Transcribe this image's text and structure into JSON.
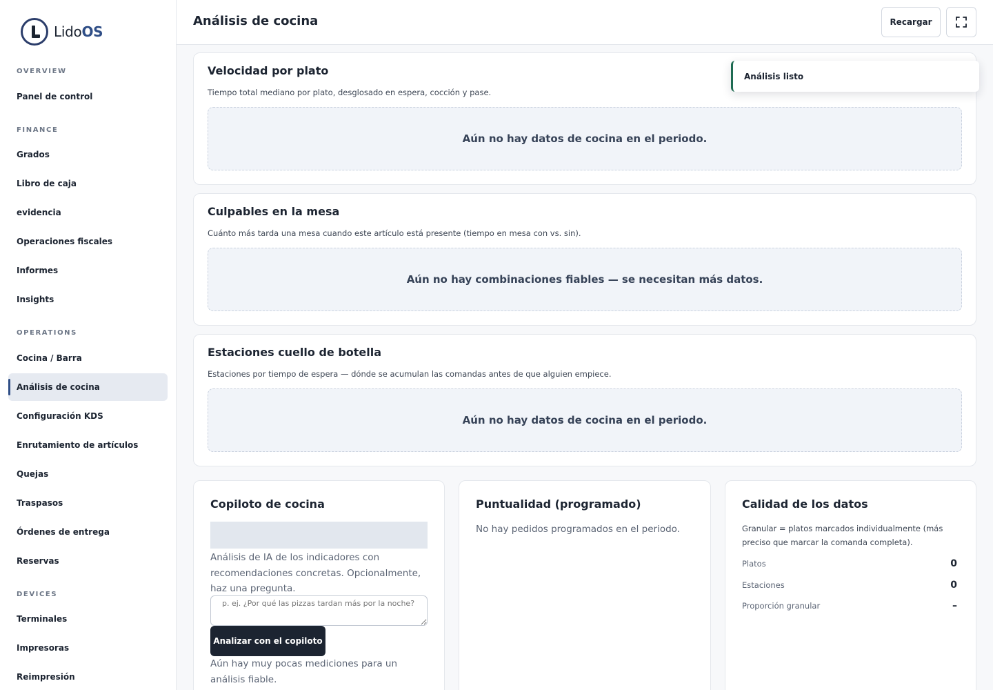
{
  "app": {
    "logo_main": "Lido",
    "logo_accent": "OS"
  },
  "sidebar": {
    "sections": [
      {
        "label": "OVERVIEW"
      },
      {
        "label": "FINANCE"
      },
      {
        "label": "OPERATIONS"
      },
      {
        "label": "DEVICES"
      }
    ],
    "items": [
      {
        "label": "Panel de control"
      },
      {
        "label": "Grados"
      },
      {
        "label": "Libro de caja"
      },
      {
        "label": "evidencia"
      },
      {
        "label": "Operaciones fiscales"
      },
      {
        "label": "Informes"
      },
      {
        "label": "Insights"
      },
      {
        "label": "Cocina / Barra"
      },
      {
        "label": "Análisis de cocina"
      },
      {
        "label": "Configuración KDS"
      },
      {
        "label": "Enrutamiento de artículos"
      },
      {
        "label": "Quejas"
      },
      {
        "label": "Traspasos"
      },
      {
        "label": "Órdenes de entrega"
      },
      {
        "label": "Reservas"
      },
      {
        "label": "Terminales"
      },
      {
        "label": "Impresoras"
      },
      {
        "label": "Reimpresión"
      }
    ],
    "active_item": "Análisis de cocina"
  },
  "header": {
    "title": "Análisis de cocina",
    "reload_label": "Recargar",
    "fullscreen_icon": "fullscreen-icon"
  },
  "toast": {
    "message": "Análisis listo"
  },
  "cards": {
    "speed": {
      "title": "Velocidad por plato",
      "subtitle": "Tiempo total mediano por plato, desglosado en espera, cocción y pase.",
      "empty": "Aún no hay datos de cocina en el periodo."
    },
    "culprits": {
      "title": "Culpables en la mesa",
      "subtitle": "Cuánto más tarda una mesa cuando este artículo está presente (tiempo en mesa con vs. sin).",
      "empty": "Aún no hay combinaciones fiables — se necesitan más datos."
    },
    "stations": {
      "title": "Estaciones cuello de botella",
      "subtitle": "Estaciones por tiempo de espera — dónde se acumulan las comandas antes de que alguien empiece.",
      "empty": "Aún no hay datos de cocina en el periodo."
    },
    "copilot": {
      "title": "Copiloto de cocina",
      "description": "Análisis de IA de los indicadores con recomendaciones concretas. Opcionalmente, haz una pregunta.",
      "placeholder": "p. ej. ¿Por qué las pizzas tardan más por la noche?",
      "button": "Analizar con el copiloto",
      "note": "Aún hay muy pocas mediciones para un análisis fiable."
    },
    "punctuality": {
      "title": "Puntualidad (programado)",
      "text": "No hay pedidos programados en el periodo."
    },
    "quality": {
      "title": "Calidad de los datos",
      "description": "Granular = platos marcados individualmente (más preciso que marcar la comanda completa).",
      "rows": [
        {
          "label": "Platos",
          "value": "0"
        },
        {
          "label": "Estaciones",
          "value": "0"
        },
        {
          "label": "Proporción granular",
          "value": "–"
        }
      ]
    }
  }
}
